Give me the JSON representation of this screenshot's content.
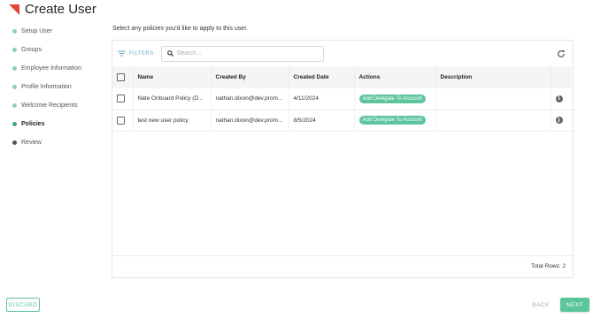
{
  "page": {
    "title": "Create User"
  },
  "steps": [
    {
      "label": "Setup User",
      "state": "done"
    },
    {
      "label": "Groups",
      "state": "done"
    },
    {
      "label": "Employee Information",
      "state": "done"
    },
    {
      "label": "Profile Information",
      "state": "done"
    },
    {
      "label": "Welcome Recipients",
      "state": "done"
    },
    {
      "label": "Policies",
      "state": "active"
    },
    {
      "label": "Review",
      "state": "pending"
    }
  ],
  "intro_text": "Select any policies you'd like to apply to this user.",
  "toolbar": {
    "filters_label": "FILTERS",
    "search_placeholder": "Search..."
  },
  "table": {
    "columns": [
      "Name",
      "Created By",
      "Created Date",
      "Actions",
      "Description"
    ],
    "rows": [
      {
        "name": "Nate Onboard Policy (D...",
        "created_by": "nathan.dixon@dev.prom...",
        "created_date": "4/11/2024",
        "action": "Add Delegate To Account",
        "description": ""
      },
      {
        "name": "test new user policy",
        "created_by": "nathan.dixon@dev.prom...",
        "created_date": "8/5/2024",
        "action": "Add Delegate To Account",
        "description": ""
      }
    ],
    "total_rows": "Total Rows: 2"
  },
  "buttons": {
    "discard": "DISCARD",
    "back": "BACK",
    "next": "NEXT"
  },
  "colors": {
    "accent": "#5cc59d",
    "brand_logo": "#e0463c",
    "filters": "#6aa5c8"
  }
}
